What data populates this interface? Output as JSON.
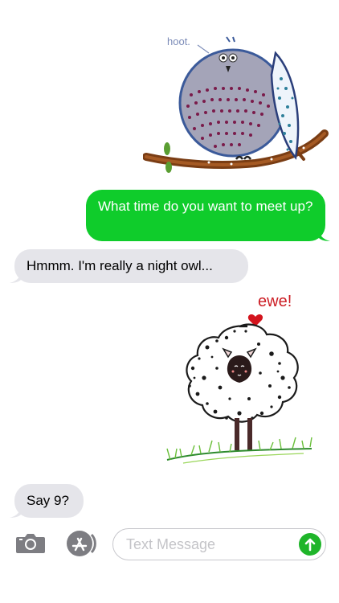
{
  "messages": [
    {
      "type": "sticker",
      "name": "owl-sticker",
      "caption": "hoot."
    },
    {
      "type": "text",
      "direction": "out",
      "text": "What time do you want to meet up?"
    },
    {
      "type": "text",
      "direction": "in",
      "text": "Hmmm. I'm really a night owl..."
    },
    {
      "type": "sticker",
      "name": "sheep-sticker",
      "caption": "ewe!"
    },
    {
      "type": "text",
      "direction": "in",
      "text": "Say 9?"
    }
  ],
  "input_bar": {
    "camera_icon": "camera-icon",
    "appstore_icon": "app-store-icon",
    "placeholder": "Text Message",
    "send_icon": "send-arrow-icon"
  },
  "colors": {
    "outgoing_bubble": "#0fcc2b",
    "incoming_bubble": "#e5e5ea",
    "send_button": "#1fb52a",
    "icon_gray": "#7d7d82"
  }
}
